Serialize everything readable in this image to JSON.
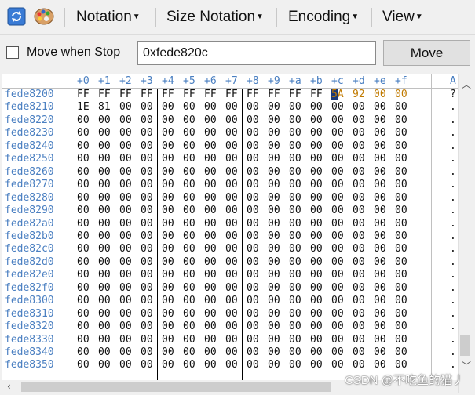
{
  "toolbar": {
    "menus": [
      {
        "label": "Notation"
      },
      {
        "label": "Size Notation"
      },
      {
        "label": "Encoding"
      },
      {
        "label": "View"
      }
    ]
  },
  "controls": {
    "move_when_stop_label": "Move when Stop",
    "address_value": "0xfede820c",
    "move_button_label": "Move"
  },
  "hex": {
    "column_headers": [
      "+0",
      "+1",
      "+2",
      "+3",
      "+4",
      "+5",
      "+6",
      "+7",
      "+8",
      "+9",
      "+a",
      "+b",
      "+c",
      "+d",
      "+e",
      "+f"
    ],
    "ascii_header": "A",
    "rows": [
      {
        "address": "fede8200",
        "bytes": [
          "FF",
          "FF",
          "FF",
          "FF",
          "FF",
          "FF",
          "FF",
          "FF",
          "FF",
          "FF",
          "FF",
          "FF",
          "5A",
          "92",
          "00",
          "00"
        ]
      },
      {
        "address": "fede8210",
        "bytes": [
          "1E",
          "81",
          "00",
          "00",
          "00",
          "00",
          "00",
          "00",
          "00",
          "00",
          "00",
          "00",
          "00",
          "00",
          "00",
          "00"
        ]
      },
      {
        "address": "fede8220",
        "bytes": [
          "00",
          "00",
          "00",
          "00",
          "00",
          "00",
          "00",
          "00",
          "00",
          "00",
          "00",
          "00",
          "00",
          "00",
          "00",
          "00"
        ]
      },
      {
        "address": "fede8230",
        "bytes": [
          "00",
          "00",
          "00",
          "00",
          "00",
          "00",
          "00",
          "00",
          "00",
          "00",
          "00",
          "00",
          "00",
          "00",
          "00",
          "00"
        ]
      },
      {
        "address": "fede8240",
        "bytes": [
          "00",
          "00",
          "00",
          "00",
          "00",
          "00",
          "00",
          "00",
          "00",
          "00",
          "00",
          "00",
          "00",
          "00",
          "00",
          "00"
        ]
      },
      {
        "address": "fede8250",
        "bytes": [
          "00",
          "00",
          "00",
          "00",
          "00",
          "00",
          "00",
          "00",
          "00",
          "00",
          "00",
          "00",
          "00",
          "00",
          "00",
          "00"
        ]
      },
      {
        "address": "fede8260",
        "bytes": [
          "00",
          "00",
          "00",
          "00",
          "00",
          "00",
          "00",
          "00",
          "00",
          "00",
          "00",
          "00",
          "00",
          "00",
          "00",
          "00"
        ]
      },
      {
        "address": "fede8270",
        "bytes": [
          "00",
          "00",
          "00",
          "00",
          "00",
          "00",
          "00",
          "00",
          "00",
          "00",
          "00",
          "00",
          "00",
          "00",
          "00",
          "00"
        ]
      },
      {
        "address": "fede8280",
        "bytes": [
          "00",
          "00",
          "00",
          "00",
          "00",
          "00",
          "00",
          "00",
          "00",
          "00",
          "00",
          "00",
          "00",
          "00",
          "00",
          "00"
        ]
      },
      {
        "address": "fede8290",
        "bytes": [
          "00",
          "00",
          "00",
          "00",
          "00",
          "00",
          "00",
          "00",
          "00",
          "00",
          "00",
          "00",
          "00",
          "00",
          "00",
          "00"
        ]
      },
      {
        "address": "fede82a0",
        "bytes": [
          "00",
          "00",
          "00",
          "00",
          "00",
          "00",
          "00",
          "00",
          "00",
          "00",
          "00",
          "00",
          "00",
          "00",
          "00",
          "00"
        ]
      },
      {
        "address": "fede82b0",
        "bytes": [
          "00",
          "00",
          "00",
          "00",
          "00",
          "00",
          "00",
          "00",
          "00",
          "00",
          "00",
          "00",
          "00",
          "00",
          "00",
          "00"
        ]
      },
      {
        "address": "fede82c0",
        "bytes": [
          "00",
          "00",
          "00",
          "00",
          "00",
          "00",
          "00",
          "00",
          "00",
          "00",
          "00",
          "00",
          "00",
          "00",
          "00",
          "00"
        ]
      },
      {
        "address": "fede82d0",
        "bytes": [
          "00",
          "00",
          "00",
          "00",
          "00",
          "00",
          "00",
          "00",
          "00",
          "00",
          "00",
          "00",
          "00",
          "00",
          "00",
          "00"
        ]
      },
      {
        "address": "fede82e0",
        "bytes": [
          "00",
          "00",
          "00",
          "00",
          "00",
          "00",
          "00",
          "00",
          "00",
          "00",
          "00",
          "00",
          "00",
          "00",
          "00",
          "00"
        ]
      },
      {
        "address": "fede82f0",
        "bytes": [
          "00",
          "00",
          "00",
          "00",
          "00",
          "00",
          "00",
          "00",
          "00",
          "00",
          "00",
          "00",
          "00",
          "00",
          "00",
          "00"
        ]
      },
      {
        "address": "fede8300",
        "bytes": [
          "00",
          "00",
          "00",
          "00",
          "00",
          "00",
          "00",
          "00",
          "00",
          "00",
          "00",
          "00",
          "00",
          "00",
          "00",
          "00"
        ]
      },
      {
        "address": "fede8310",
        "bytes": [
          "00",
          "00",
          "00",
          "00",
          "00",
          "00",
          "00",
          "00",
          "00",
          "00",
          "00",
          "00",
          "00",
          "00",
          "00",
          "00"
        ]
      },
      {
        "address": "fede8320",
        "bytes": [
          "00",
          "00",
          "00",
          "00",
          "00",
          "00",
          "00",
          "00",
          "00",
          "00",
          "00",
          "00",
          "00",
          "00",
          "00",
          "00"
        ]
      },
      {
        "address": "fede8330",
        "bytes": [
          "00",
          "00",
          "00",
          "00",
          "00",
          "00",
          "00",
          "00",
          "00",
          "00",
          "00",
          "00",
          "00",
          "00",
          "00",
          "00"
        ]
      },
      {
        "address": "fede8340",
        "bytes": [
          "00",
          "00",
          "00",
          "00",
          "00",
          "00",
          "00",
          "00",
          "00",
          "00",
          "00",
          "00",
          "00",
          "00",
          "00",
          "00"
        ]
      },
      {
        "address": "fede8350",
        "bytes": [
          "00",
          "00",
          "00",
          "00",
          "00",
          "00",
          "00",
          "00",
          "00",
          "00",
          "00",
          "00",
          "00",
          "00",
          "00",
          "00"
        ]
      }
    ],
    "ascii_rows": [
      "?",
      ".",
      ".",
      ".",
      ".",
      ".",
      ".",
      ".",
      ".",
      ".",
      ".",
      ".",
      ".",
      ".",
      ".",
      ".",
      ".",
      ".",
      ".",
      ".",
      ".",
      "."
    ]
  },
  "colors": {
    "address": "#4a7fc1",
    "changed": "#c07a00",
    "cursor_bg": "#1a3a7a"
  },
  "watermark": "CSDN @不吃鱼的猫丿"
}
